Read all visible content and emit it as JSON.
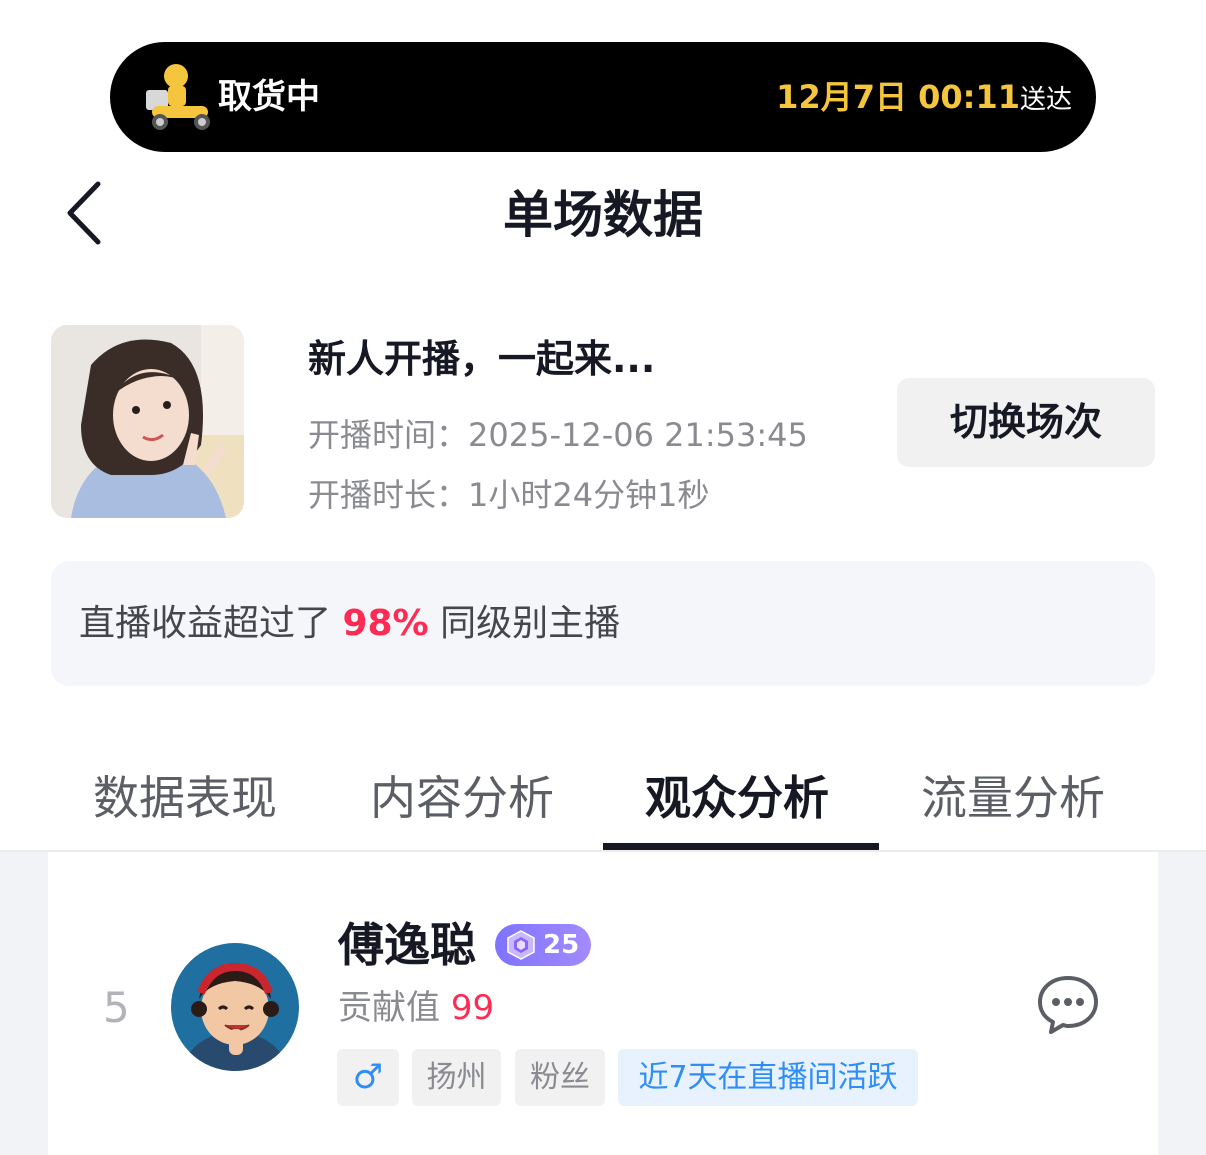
{
  "delivery": {
    "status": "取货中",
    "eta_time": "12月7日 00:11",
    "eta_suffix": "送达",
    "icon": "courier-scooter-icon"
  },
  "header": {
    "title": "单场数据",
    "back_icon": "chevron-left-icon"
  },
  "session": {
    "title": "新人开播，一起来...",
    "start_time": "开播时间：2025-12-06 21:53:45",
    "duration": "开播时长：1小时24分钟1秒",
    "switch_button": "切换场次"
  },
  "rank_banner": {
    "prefix": "直播收益超过了 ",
    "percent": "98%",
    "suffix": " 同级别主播"
  },
  "tabs": [
    {
      "label": "数据表现",
      "active": false
    },
    {
      "label": "内容分析",
      "active": false
    },
    {
      "label": "观众分析",
      "active": true
    },
    {
      "label": "流量分析",
      "active": false
    }
  ],
  "audience": {
    "rank": "5",
    "name": "傅逸聪",
    "level": "25",
    "contribution_label": "贡献值 ",
    "contribution_value": "99",
    "tags": {
      "gender": "♂",
      "city": "扬州",
      "relation": "粉丝",
      "activity": "近7天在直播间活跃"
    },
    "action_icon": "chat-bubble-icon"
  },
  "colors": {
    "accent": "#fe2c55",
    "eta": "#f5c53d",
    "link_blue": "#2f8ef5",
    "level_badge": "#8b7bff"
  }
}
